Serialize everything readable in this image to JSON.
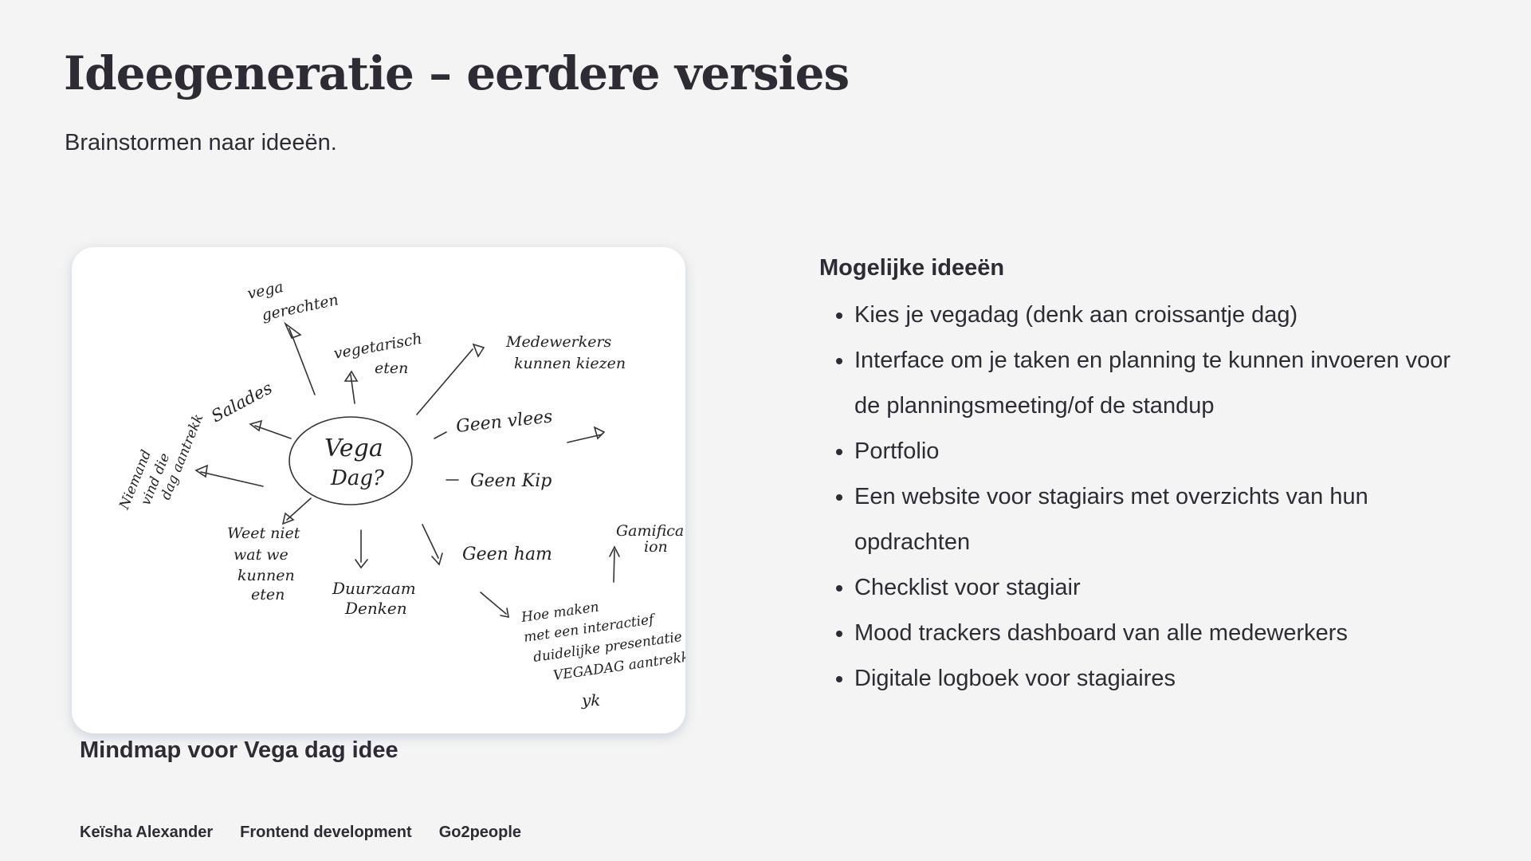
{
  "slide": {
    "title": "Ideegeneratie – eerdere versies",
    "subtitle": "Brainstormen naar ideeën."
  },
  "image": {
    "caption": "Mindmap voor Vega dag idee",
    "sketch_words": {
      "center": [
        "Vega",
        "Dag?"
      ],
      "vega_gerechten": [
        "vega",
        "gerechten"
      ],
      "vegetarisch_eten": [
        "vegetarisch",
        "eten"
      ],
      "medewerkers_kunnen_kiezen": [
        "Medewerkers",
        "kunnen kiezen"
      ],
      "salades": "Salades",
      "niemand_vind_die_dag_aantrekkelijk": [
        "Niemand",
        "vind die",
        "dag aantrekk"
      ],
      "geen_vlees": "Geen vlees",
      "geen_kip": "Geen Kip",
      "weet_niet": [
        "Weet niet",
        "wat we",
        "kunnen",
        "eten"
      ],
      "duurzaam_denken": [
        "Duurzaam",
        "Denken"
      ],
      "geen_ham": "Geen ham",
      "gamification": [
        "Gamifica",
        "ion"
      ],
      "hoe_maken": [
        "Hoe maken",
        "met een interactief",
        "duidelijke presentatie",
        "VEGADAG aantrekk"
      ],
      "signature": "yk"
    }
  },
  "ideas": {
    "heading": "Mogelijke ideeën",
    "items": [
      "Kies je vegadag (denk aan croissantje dag)",
      "Interface om je taken en  planning te kunnen invoeren voor de planningsmeeting/of de standup",
      "Portfolio",
      "Een website voor stagiairs met overzichts van hun opdrachten",
      "Checklist voor stagiair",
      "Mood trackers dashboard van alle medewerkers",
      "Digitale logboek voor stagiaires"
    ]
  },
  "footer": {
    "author": "Keïsha Alexander",
    "course": "Frontend development",
    "company": "Go2people"
  }
}
